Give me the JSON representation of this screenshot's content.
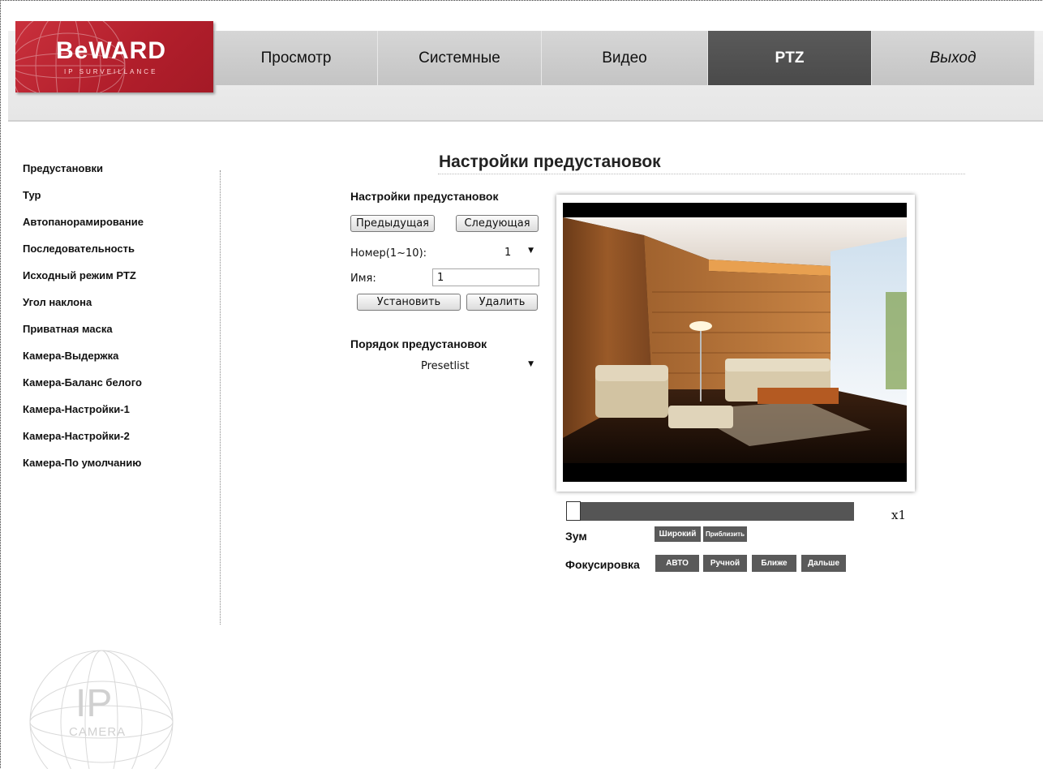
{
  "brand": {
    "logo_text": "BeWARD",
    "logo_sub": "IP SURVEILLANCE"
  },
  "nav": [
    {
      "label": "Просмотр",
      "active": false
    },
    {
      "label": "Системные",
      "active": false
    },
    {
      "label": "Видео",
      "active": false
    },
    {
      "label": "PTZ",
      "active": true
    },
    {
      "label": "Выход",
      "active": false
    }
  ],
  "sidebar": {
    "items": [
      "Предустановки",
      "Тур",
      "Автопанорамирование",
      "Последовательность",
      "Исходный режим PTZ",
      "Угол наклона",
      "Приватная маска",
      "Камера-Выдержка",
      "Камера-Баланс белого",
      "Камера-Настройки-1",
      "Камера-Настройки-2",
      "Камера-По умолчанию"
    ]
  },
  "watermark": {
    "text_big": "IP",
    "text_small": "CAMERA"
  },
  "main": {
    "title": "Настройки предустановок",
    "preset": {
      "section_title": "Настройки предустановок",
      "prev_label": "Предыдущая",
      "next_label": "Следующая",
      "number_label": "Номер(1~10):",
      "number_value": "1",
      "name_label": "Имя:",
      "name_value": "1",
      "set_label": "Установить",
      "delete_label": "Удалить"
    },
    "order": {
      "section_title": "Порядок предустановок",
      "selected": "Presetlist"
    }
  },
  "ptz": {
    "zoom_level": "x1",
    "zoom_fraction": 0.0,
    "zoom_label": "Зум",
    "wide_label": "Широкий",
    "tele_label": "Приблизить",
    "focus_label": "Фокусировка",
    "focus_buttons": [
      "АВТО",
      "Ручной",
      "Ближе",
      "Дальше"
    ]
  },
  "colors": {
    "brand_red": "#b8202d",
    "nav_active": "#4f4f4f",
    "control_dark": "#5a5a5a"
  }
}
